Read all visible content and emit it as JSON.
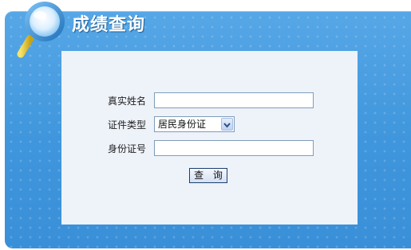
{
  "header": {
    "title": "成绩查询",
    "icon": "magnifier-icon"
  },
  "form": {
    "name_label": "真实姓名",
    "name_value": "",
    "id_type_label": "证件类型",
    "id_type_selected": "居民身份证",
    "id_number_label": "身份证号",
    "id_number_value": "",
    "submit_label": "查 询"
  },
  "colors": {
    "panel_blue": "#3f96dc",
    "content_background": "#eef2f9",
    "input_border": "#7f9db9",
    "button_border": "#1b3f6e"
  }
}
